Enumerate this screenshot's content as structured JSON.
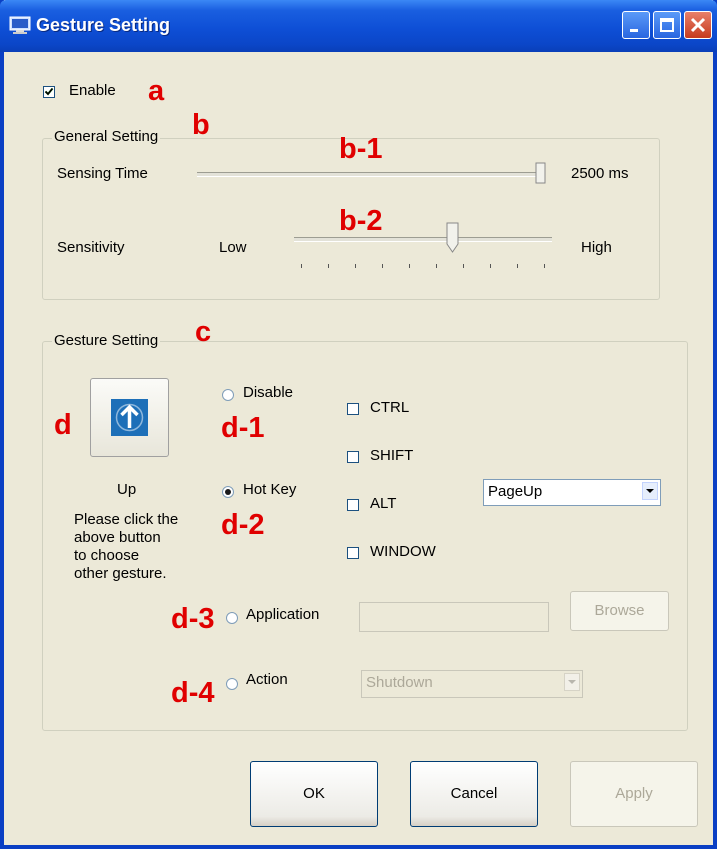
{
  "window": {
    "title": "Gesture Setting"
  },
  "enable": {
    "label": "Enable",
    "checked": true
  },
  "general": {
    "title": "General Setting",
    "sensing_time": {
      "label": "Sensing Time",
      "value": "2500 ms",
      "level": 1.0
    },
    "sensitivity": {
      "label": "Sensitivity",
      "low": "Low",
      "high": "High",
      "level": 0.62
    }
  },
  "gesture": {
    "title": "Gesture Setting",
    "current_label": "Up",
    "hint_lines": [
      "Please click the",
      "above button",
      "to choose",
      "other gesture."
    ],
    "options": {
      "disable": "Disable",
      "hotkey": "Hot Key",
      "application": "Application",
      "action": "Action"
    },
    "modifiers": {
      "ctrl": "CTRL",
      "shift": "SHIFT",
      "alt": "ALT",
      "window": "WINDOW"
    },
    "hotkey_value": "PageUp",
    "browse": "Browse",
    "action_value": "Shutdown"
  },
  "buttons": {
    "ok": "OK",
    "cancel": "Cancel",
    "apply": "Apply"
  },
  "annotations": {
    "a": "a",
    "b": "b",
    "b1": "b-1",
    "b2": "b-2",
    "c": "c",
    "d": "d",
    "d1": "d-1",
    "d2": "d-2",
    "d3": "d-3",
    "d4": "d-4"
  },
  "colors": {
    "title_bar": "#0b46c8",
    "annotation": "#e00000",
    "dialog_bg": "#ece9d8",
    "gesture_icon": "#1d6fb8"
  }
}
